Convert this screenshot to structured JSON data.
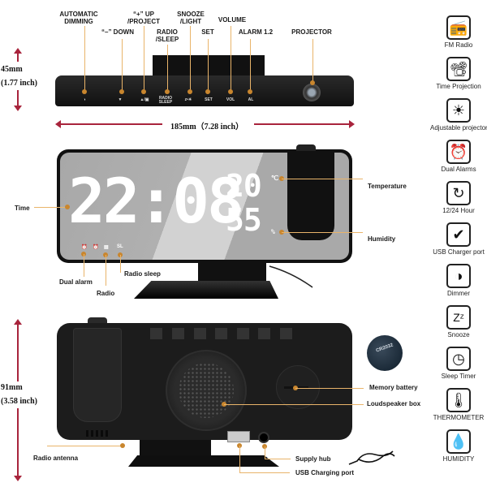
{
  "top_view": {
    "callouts": [
      {
        "id": "automatic-dimming",
        "label": "AUTOMATIC\nDIMMING"
      },
      {
        "id": "down",
        "label": "“–” DOWN"
      },
      {
        "id": "up-project",
        "label": "“+” UP\n/PROJECT"
      },
      {
        "id": "radio-sleep",
        "label": "RADIO\n/SLEEP"
      },
      {
        "id": "snooze-light",
        "label": "SNOOZE\n/LIGHT"
      },
      {
        "id": "set",
        "label": "SET"
      },
      {
        "id": "volume",
        "label": "VOLUME"
      },
      {
        "id": "alarm",
        "label": "ALARM 1.2"
      },
      {
        "id": "projector",
        "label": "PROJECTOR"
      }
    ],
    "button_marks": [
      "◑",
      "▼",
      "▲/▣",
      "RADIO\nSLEEP",
      "z•☀",
      "SET",
      "VOL",
      "AL"
    ],
    "height_dimension": {
      "mm": "45mm",
      "inch": "(1.77 inch)"
    },
    "width_dimension": "185mm（7.28 inch）"
  },
  "front_view": {
    "time_display": "22:08",
    "temperature_value": "20",
    "temperature_unit": "℃",
    "humidity_value": "55",
    "humidity_unit": "%",
    "indicator_icons": [
      "alarm-1",
      "alarm-2",
      "radio",
      "SL"
    ],
    "indicator_sl": "SL",
    "callouts": {
      "time": "Time",
      "temperature": "Temperature",
      "humidity": "Humidity",
      "dual_alarm": "Dual alarm",
      "radio": "Radio",
      "radio_sleep": "Radio sleep"
    }
  },
  "back_view": {
    "height_dimension": {
      "mm": "91mm",
      "inch": "(3.58 inch)"
    },
    "battery_model": "CR2032",
    "callouts": {
      "memory_battery": "Memory battery",
      "loudspeaker_box": "Loudspeaker box",
      "radio_antenna": "Radio antenna",
      "supply_hub": "Supply hub",
      "usb_charging_port": "USB Charging port"
    }
  },
  "features": [
    {
      "icon": "radio-icon",
      "glyph": "📻",
      "label": "FM Radio"
    },
    {
      "icon": "projector-icon",
      "glyph": "📽",
      "label": "Time Projection"
    },
    {
      "icon": "adjustable-projector-icon",
      "glyph": "☀",
      "label": "Adjustable projector"
    },
    {
      "icon": "alarm-clock-icon",
      "glyph": "⏰",
      "label": "Dual Alarms"
    },
    {
      "icon": "clock-cycle-icon",
      "glyph": "↻",
      "label": "12/24 Hour"
    },
    {
      "icon": "usb-charger-icon",
      "glyph": "✔",
      "label": "USB Charger port"
    },
    {
      "icon": "dimmer-icon",
      "glyph": "◑",
      "label": "Dimmer"
    },
    {
      "icon": "snooze-icon",
      "glyph": "Zᶻ",
      "label": "Snooze"
    },
    {
      "icon": "sleep-timer-icon",
      "glyph": "◷",
      "label": "Sleep Timer"
    },
    {
      "icon": "thermometer-icon",
      "glyph": "🌡",
      "label": "THERMOMETER"
    },
    {
      "icon": "humidity-icon",
      "glyph": "💧",
      "label": "HUMIDITY"
    }
  ],
  "colors": {
    "callout_line": "#e9b46a",
    "callout_dot": "#c9862e",
    "dimension_arrow": "#a8243c",
    "device_body": "#1c1c1c"
  }
}
